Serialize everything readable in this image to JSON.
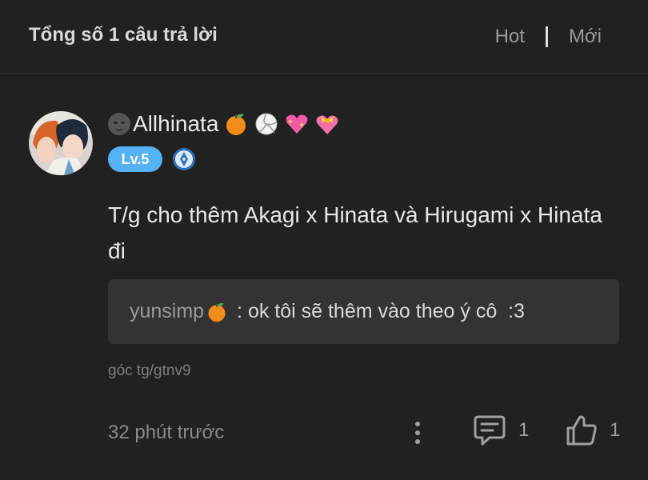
{
  "header": {
    "title": "Tổng số 1 câu trả lời",
    "sort_hot": "Hot",
    "sort_new": "Mới"
  },
  "comment": {
    "username": "Allhinata",
    "level": "Lv.5",
    "text": "T/g cho thêm Akagi x Hinata và Hirugami x Hinata đi",
    "reply": {
      "user": "yunsimp",
      "separator": " : ",
      "text": "ok tôi sẽ thêm vào theo ý cô  :3"
    },
    "source": "góc tg/gtnv9",
    "time": "32 phút trước",
    "comment_count": "1",
    "like_count": "1"
  },
  "icons": {
    "name_emojis": [
      "new-moon-face",
      "tangerine",
      "volleyball",
      "sparkling-heart",
      "heart-with-ribbon"
    ],
    "actions": [
      "more-vertical-icon",
      "comment-icon",
      "thumbs-up-icon"
    ]
  },
  "colors": {
    "background": "#212121",
    "level_badge": "#55b3f5",
    "reply_box": "#333333"
  }
}
